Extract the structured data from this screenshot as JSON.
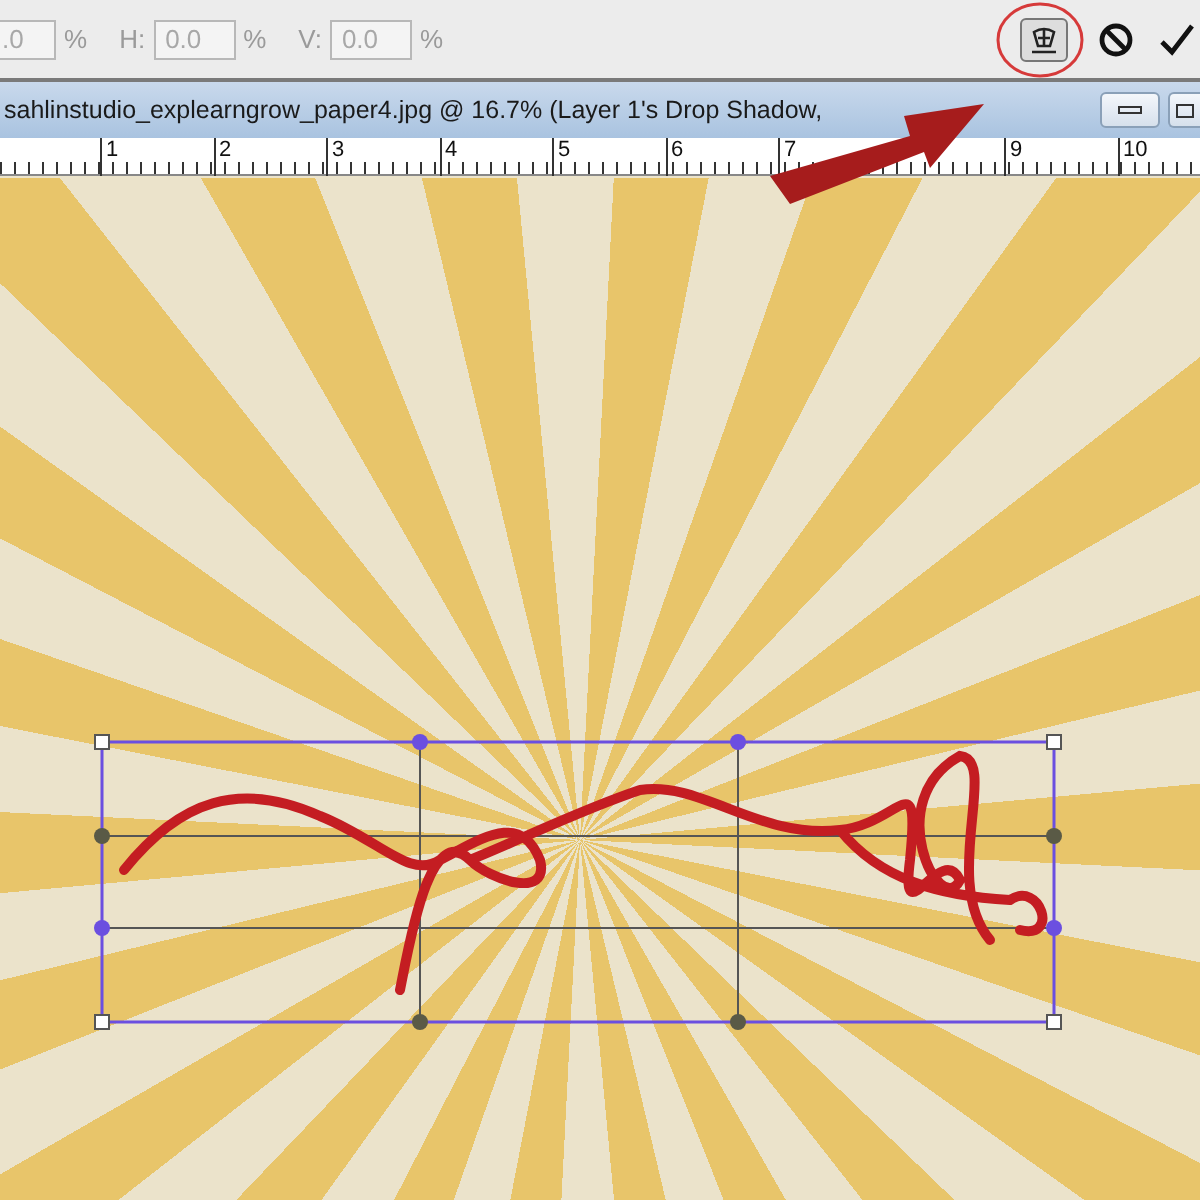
{
  "options_bar": {
    "fields": [
      {
        "value": ".0",
        "unit": "%"
      },
      {
        "label": "H:",
        "value": "0.0",
        "unit": "%"
      },
      {
        "label": "V:",
        "value": "0.0",
        "unit": "%"
      }
    ]
  },
  "document": {
    "title": "sahlinstudio_explearngrow_paper4.jpg @ 16.7% (Layer 1's Drop Shadow,"
  },
  "ruler": {
    "marks": [
      "1",
      "2",
      "3",
      "4",
      "5",
      "6",
      "7",
      "9",
      "10"
    ]
  }
}
